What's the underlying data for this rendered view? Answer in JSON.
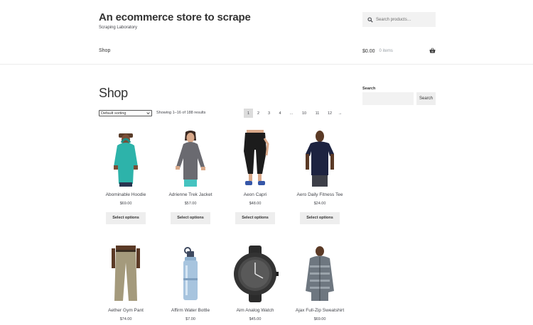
{
  "header": {
    "site_title": "An ecommerce store to scrape",
    "tagline": "Scraping Laboratory",
    "search_placeholder": "Search products…"
  },
  "nav": {
    "shop_label": "Shop"
  },
  "cart": {
    "amount": "$0.00",
    "count": "0 items"
  },
  "main": {
    "title": "Shop",
    "sort_selected": "Default sorting",
    "result_count": "Showing 1–16 of 188 results",
    "pagination": [
      "1",
      "2",
      "3",
      "4",
      "…",
      "10",
      "11",
      "12",
      "→"
    ]
  },
  "sidebar": {
    "search_label": "Search",
    "search_button": "Search"
  },
  "products": [
    {
      "name": "Abominable Hoodie",
      "price": "$69.00",
      "button": "Select options"
    },
    {
      "name": "Adrienne Trek Jacket",
      "price": "$57.00",
      "button": "Select options"
    },
    {
      "name": "Aeon Capri",
      "price": "$48.00",
      "button": "Select options"
    },
    {
      "name": "Aero Daily Fitness Tee",
      "price": "$24.00",
      "button": "Select options"
    },
    {
      "name": "Aether Gym Pant",
      "price": "$74.00"
    },
    {
      "name": "Affirm Water Bottle",
      "price": "$7.00"
    },
    {
      "name": "Aim Analog Watch",
      "price": "$45.00"
    },
    {
      "name": "Ajax Full-Zip Sweatshirt",
      "price": "$69.00"
    }
  ]
}
